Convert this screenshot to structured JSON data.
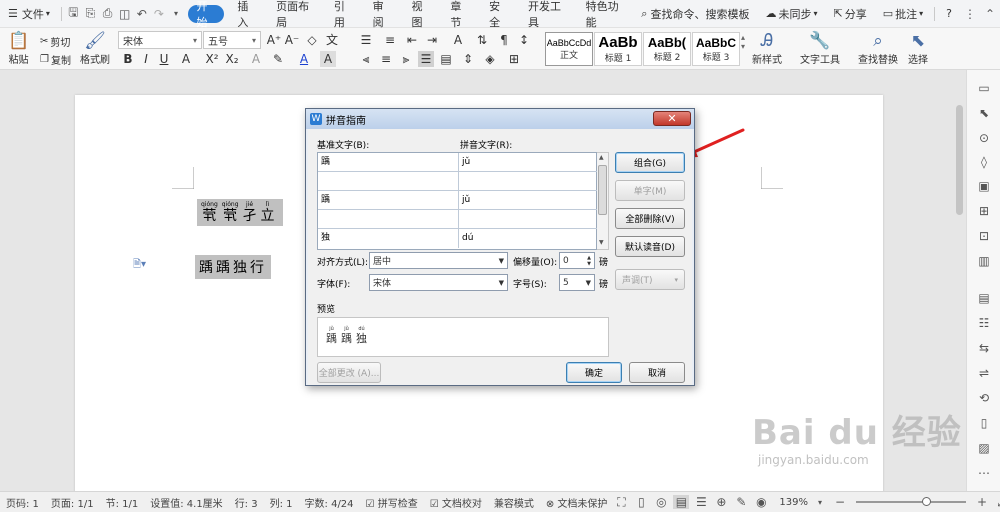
{
  "menubar": {
    "app_menu": "文件",
    "tabs": [
      "开始",
      "插入",
      "页面布局",
      "引用",
      "审阅",
      "视图",
      "章节",
      "安全",
      "开发工具",
      "特色功能"
    ],
    "active_tab": "开始",
    "search": "查找命令、搜索模板",
    "sync": "未同步",
    "share": "分享",
    "comment": "批注",
    "help": "?"
  },
  "ribbon": {
    "paste": "粘贴",
    "cut": "剪切",
    "copy": "复制",
    "format_painter": "格式刷",
    "font_name": "宋体",
    "font_size": "五号",
    "styles": [
      {
        "sample": "AaBbCcDd",
        "label": "正文"
      },
      {
        "sample": "AaBb",
        "label": "标题 1"
      },
      {
        "sample": "AaBb(",
        "label": "标题 2"
      },
      {
        "sample": "AaBbC",
        "label": "标题 3"
      }
    ],
    "new_style": "新样式",
    "text_tools": "文字工具",
    "find_replace": "查找替换",
    "select": "选择"
  },
  "document": {
    "line1": [
      {
        "pinyin": "qióng",
        "char": "茕"
      },
      {
        "pinyin": "qióng",
        "char": "茕"
      },
      {
        "pinyin": "jié",
        "char": "孑"
      },
      {
        "pinyin": "lì",
        "char": "立"
      }
    ],
    "line2": "踽踽独行"
  },
  "dialog": {
    "title": "拼音指南",
    "close": "✕",
    "base_text_label": "基准文字(B):",
    "pinyin_text_label": "拼音文字(R):",
    "rows": [
      {
        "base": "踽",
        "pinyin": "jǔ"
      },
      {
        "base": "",
        "pinyin": ""
      },
      {
        "base": "踽",
        "pinyin": "jǔ"
      },
      {
        "base": "",
        "pinyin": ""
      },
      {
        "base": "独",
        "pinyin": "dú"
      }
    ],
    "buttons": {
      "group": "组合(G)",
      "single": "单字(M)",
      "clear_all": "全部删除(V)",
      "default_reading": "默认读音(D)",
      "tone": "声调(T)",
      "apply_all": "全部更改 (A)...",
      "ok": "确定",
      "cancel": "取消"
    },
    "align_label": "对齐方式(L):",
    "align_value": "居中",
    "offset_label": "偏移量(O):",
    "offset_value": "0",
    "offset_unit": "磅",
    "font_label": "字体(F):",
    "font_value": "宋体",
    "size_label": "字号(S):",
    "size_value": "5",
    "size_unit": "磅",
    "preview_label": "预览",
    "preview": [
      {
        "pinyin": "jǔ",
        "char": "踽"
      },
      {
        "pinyin": "jǔ",
        "char": "踽"
      },
      {
        "pinyin": "dú",
        "char": "独"
      }
    ]
  },
  "statusbar": {
    "page_num": "页码: 1",
    "pages": "页面: 1/1",
    "section": "节: 1/1",
    "position": "设置值: 4.1厘米",
    "row": "行: 3",
    "col": "列: 1",
    "word_count": "字数: 4/24",
    "spell_check": "拼写检查",
    "doc_proof": "文档校对",
    "compat": "兼容模式",
    "unprotected": "文档未保护",
    "zoom": "139%",
    "zoom_level": 0.65
  },
  "watermark": {
    "logo": "Bai du 经验",
    "url": "jingyan.baidu.com"
  },
  "colors": {
    "accent": "#2b7cd3",
    "arrow": "#e02020"
  }
}
